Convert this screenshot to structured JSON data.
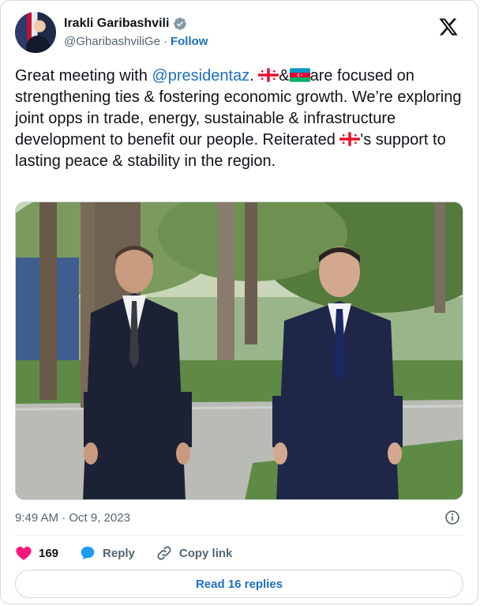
{
  "author": {
    "name": "Irakli Garibashvili",
    "handle": "@GharibashviliGe",
    "separator": "·",
    "follow_label": "Follow"
  },
  "tweet": {
    "part1": "Great meeting with ",
    "mention": "@presidentaz",
    "part2": ". ",
    "amp": "&",
    "part3": "are focused on strengthening ties & fostering economic growth. We’re exploring joint opps in trade, energy, sustainable & infrastructure development to benefit our people. Reiterated ",
    "part4": "'s support to lasting peace & stability in the region.",
    "flags": [
      "georgia-flag",
      "azerbaijan-flag"
    ]
  },
  "timestamp": "9:49 AM · Oct 9, 2023",
  "actions": {
    "likes_count": "169",
    "reply_label": "Reply",
    "copy_link_label": "Copy link"
  },
  "read_replies_label": "Read 16 replies",
  "colors": {
    "link": "#1d6fbf",
    "heart": "#f91880",
    "reply_bubble": "#1d9bf0",
    "text": "#0f1419",
    "muted": "#536471"
  }
}
